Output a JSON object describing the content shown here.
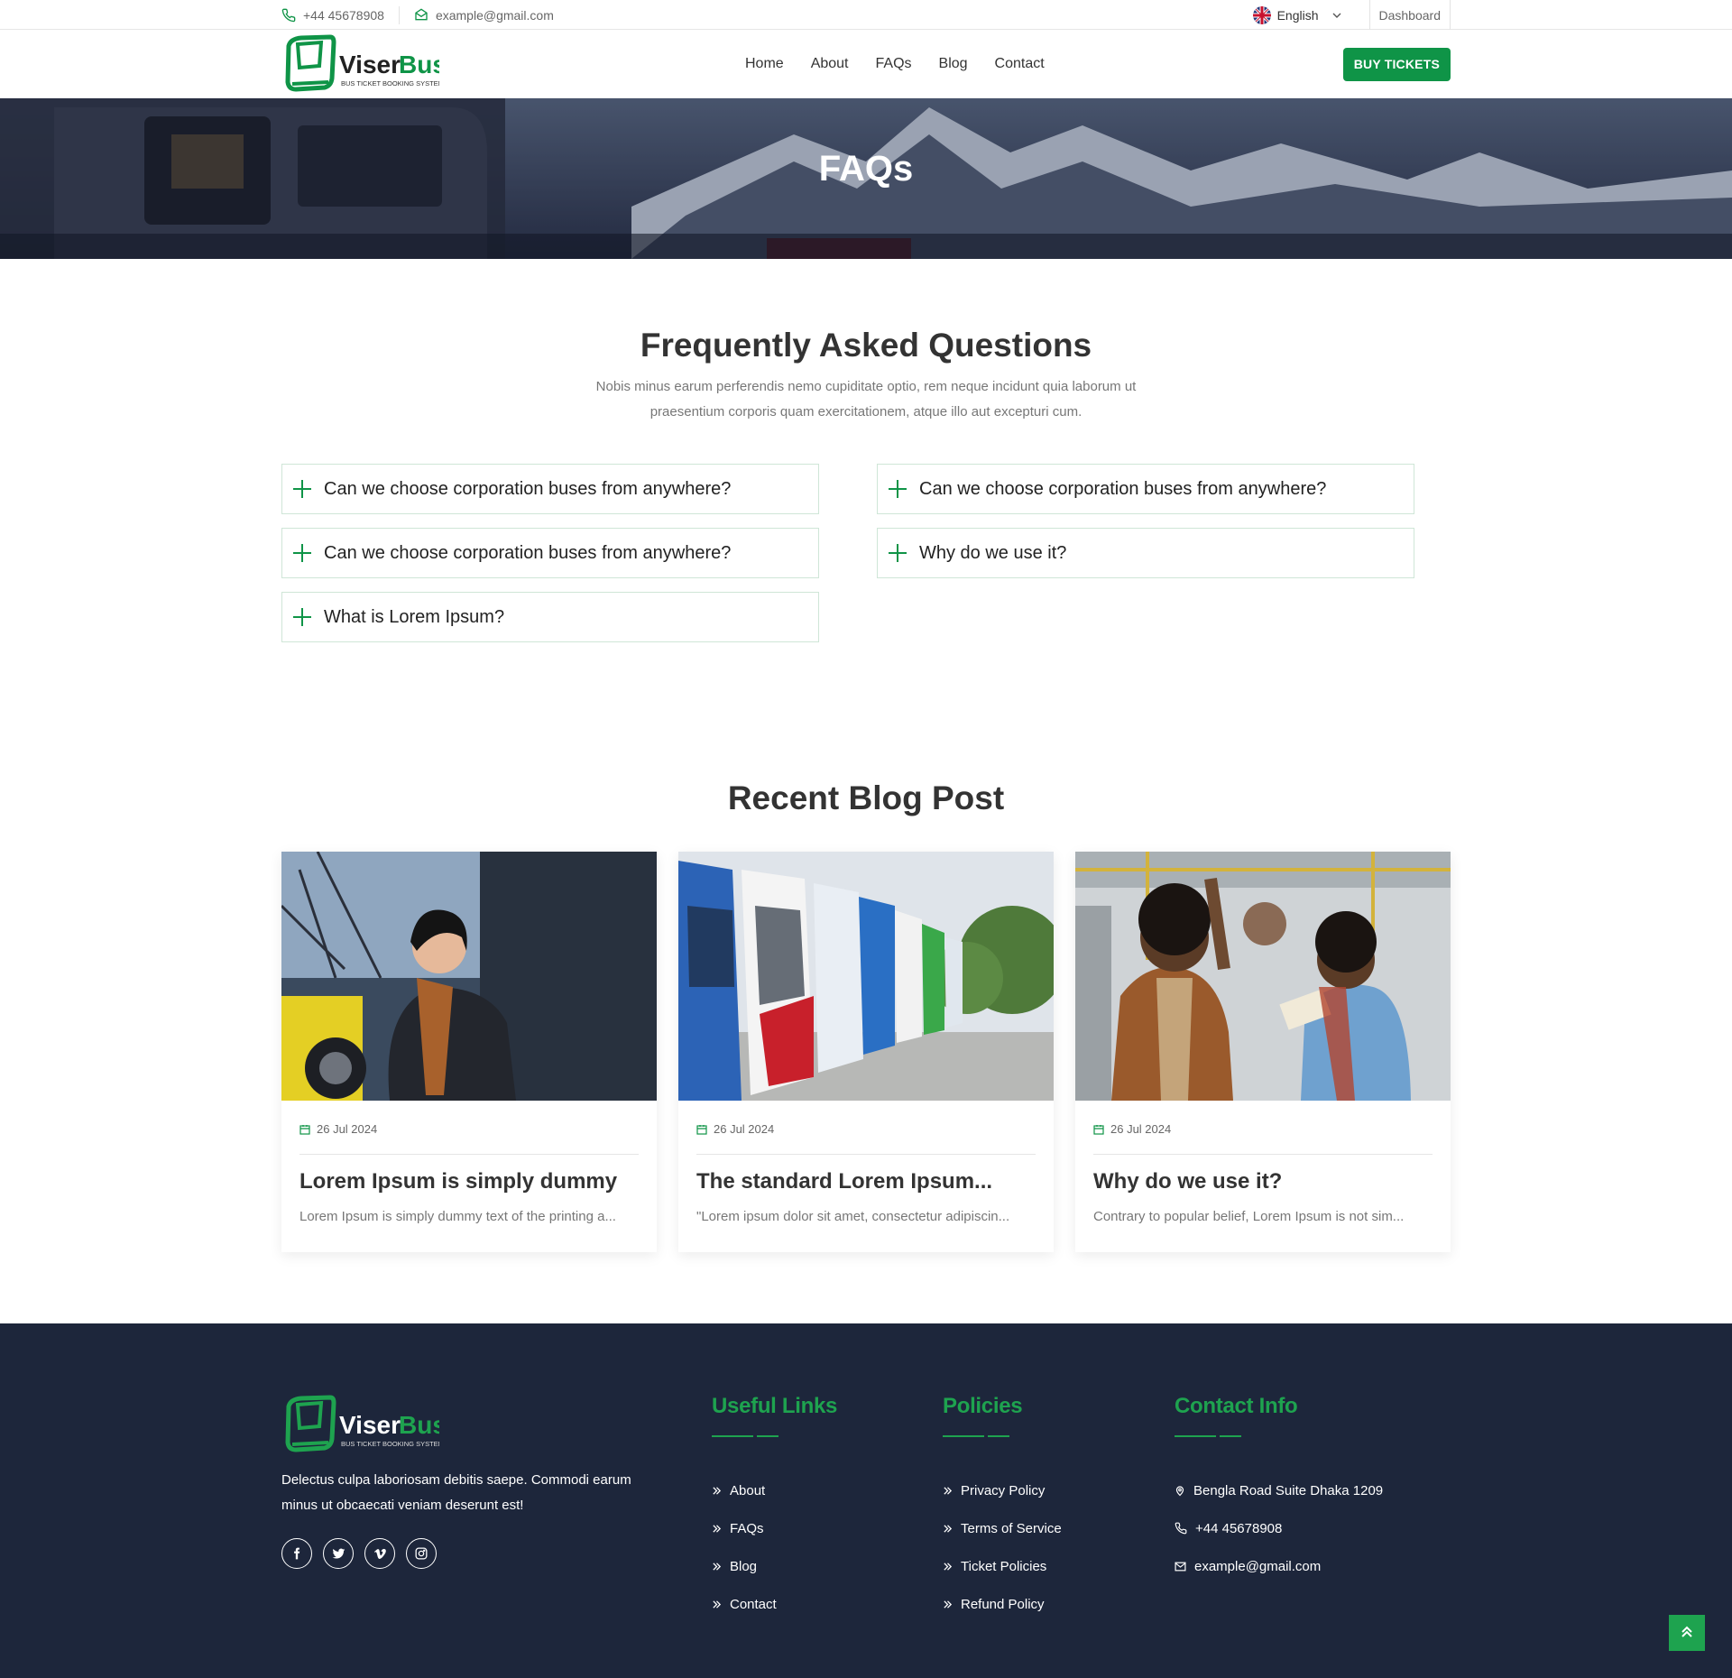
{
  "topbar": {
    "phone": "+44 45678908",
    "email": "example@gmail.com",
    "language": "English",
    "dashboard": "Dashboard"
  },
  "header": {
    "logo_main": "Viser",
    "logo_accent": "Bus",
    "logo_tagline": "BUS TICKET BOOKING SYSTEM",
    "nav": [
      "Home",
      "About",
      "FAQs",
      "Blog",
      "Contact"
    ],
    "buy_button": "BUY TICKETS"
  },
  "hero": {
    "title": "FAQs"
  },
  "faq_section": {
    "title": "Frequently Asked Questions",
    "subtitle": "Nobis minus earum perferendis nemo cupiditate optio, rem neque incidunt quia laborum ut praesentium corporis quam exercitationem, atque illo aut excepturi cum.",
    "items": [
      "Can we choose corporation buses from anywhere?",
      "Can we choose corporation buses from anywhere?",
      "Can we choose corporation buses from anywhere?",
      "Why do we use it?",
      "What is Lorem Ipsum?"
    ]
  },
  "blog_section": {
    "title": "Recent Blog Post",
    "posts": [
      {
        "date": "26 Jul 2024",
        "title": "Lorem Ipsum is simply dummy",
        "excerpt": "Lorem Ipsum is simply dummy text of the printing a..."
      },
      {
        "date": "26 Jul 2024",
        "title": "The standard Lorem Ipsum...",
        "excerpt": "\"Lorem ipsum dolor sit amet, consectetur adipiscin..."
      },
      {
        "date": "26 Jul 2024",
        "title": "Why do we use it?",
        "excerpt": "Contrary to popular belief, Lorem Ipsum is not sim..."
      }
    ]
  },
  "footer": {
    "description": "Delectus culpa laboriosam debitis saepe. Commodi earum minus ut obcaecati veniam deserunt est!",
    "social": [
      "facebook-icon",
      "twitter-icon",
      "vimeo-icon",
      "instagram-icon"
    ],
    "useful_links": {
      "title": "Useful Links",
      "items": [
        "About",
        "FAQs",
        "Blog",
        "Contact"
      ]
    },
    "policies": {
      "title": "Policies",
      "items": [
        "Privacy Policy",
        "Terms of Service",
        "Ticket Policies",
        "Refund Policy"
      ]
    },
    "contact": {
      "title": "Contact Info",
      "address": "Bengla Road Suite Dhaka 1209",
      "phone": "+44 45678908",
      "email": "example@gmail.com"
    }
  },
  "colors": {
    "accent": "#0f9447",
    "footer_bg": "#1d263b",
    "footer_heading": "#1ea34f"
  }
}
